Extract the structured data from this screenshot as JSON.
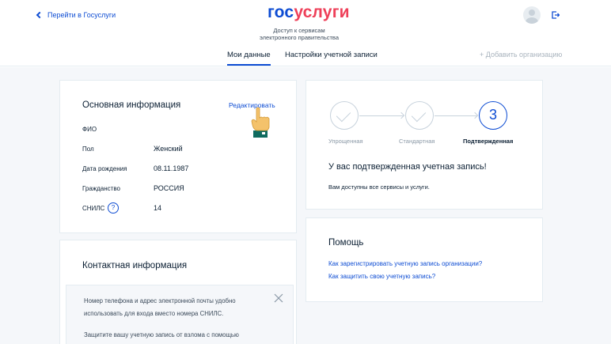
{
  "header": {
    "back_label": "Перейти в Госуслуги",
    "logo_part1": "гос",
    "logo_part2": "услуги",
    "tagline_line1": "Доступ к сервисам",
    "tagline_line2": "электронного правительства",
    "tabs": [
      {
        "label": "Мои данные",
        "active": true
      },
      {
        "label": "Настройки учетной записи",
        "active": false
      }
    ],
    "add_org": "+ Добавить организацию"
  },
  "basic_info": {
    "title": "Основная информация",
    "edit_label": "Редактировать",
    "rows": [
      {
        "label": "ФИО",
        "value": ""
      },
      {
        "label": "Пол",
        "value": "Женский"
      },
      {
        "label": "Дата рождения",
        "value": "08.11.1987"
      },
      {
        "label": "Гражданство",
        "value": "РОССИЯ"
      },
      {
        "label": "СНИЛС",
        "value": "14"
      }
    ],
    "help_symbol": "?"
  },
  "contact_info": {
    "title": "Контактная информация",
    "notice_line1": "Номер телефона и адрес электронной почты удобно",
    "notice_line2": "использовать для входа вместо номера СНИЛС.",
    "notice_line3": "Защитите вашу учетную запись от взлома с помощью"
  },
  "account_status": {
    "steps": [
      {
        "label": "Упрощенная",
        "state": "done"
      },
      {
        "label": "Стандартная",
        "state": "done"
      },
      {
        "label": "Подтвержденная",
        "state": "current",
        "number": "3"
      }
    ],
    "heading": "У вас подтвержденная учетная запись!",
    "text": "Вам доступны все сервисы и услуги."
  },
  "help_card": {
    "title": "Помощь",
    "links": [
      "Как зарегистрировать учетную запись организации?",
      "Как защитить свою учетную запись?"
    ]
  },
  "colors": {
    "accent": "#0d4cd3",
    "brand_red": "#ee3f58",
    "background": "#f5f7fa"
  },
  "icons": [
    "chevron-left-icon",
    "logout-icon",
    "avatar",
    "pointer-hand-icon",
    "close-icon",
    "check-icon"
  ]
}
